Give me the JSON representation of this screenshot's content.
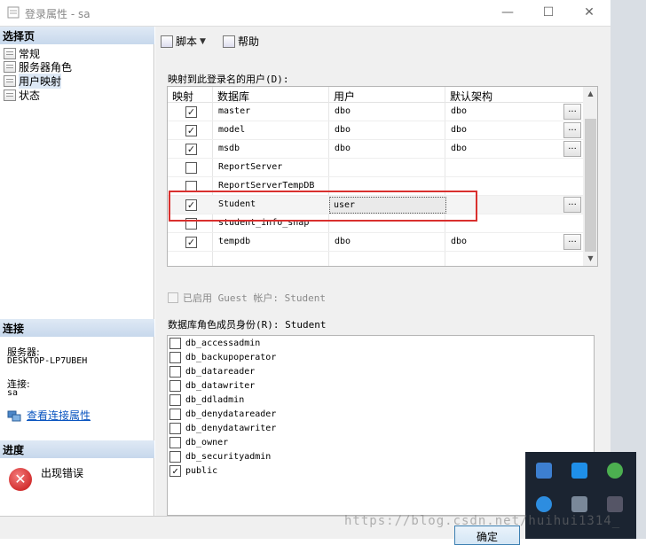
{
  "window": {
    "title": "登录属性 - sa",
    "controls": {
      "minimize": "—",
      "maximize": "☐",
      "close": "✕"
    }
  },
  "left_panel": {
    "select_page_header": "选择页",
    "pages": [
      {
        "label": "常规",
        "icon": "page-icon"
      },
      {
        "label": "服务器角色",
        "icon": "page-icon"
      },
      {
        "label": "用户映射",
        "icon": "page-icon",
        "selected": true
      },
      {
        "label": "状态",
        "icon": "page-icon"
      }
    ],
    "connection": {
      "header": "连接",
      "server_label": "服务器:",
      "server_value": "DESKTOP-LP7UBEH",
      "connection_label": "连接:",
      "connection_value": "sa",
      "view_properties_link": "查看连接属性"
    },
    "progress": {
      "header": "进度",
      "status": "出现错误",
      "status_icon": "error-icon"
    }
  },
  "toolbar": {
    "script_label": "脚本",
    "help_label": "帮助"
  },
  "mapping": {
    "title": "映射到此登录名的用户(D):",
    "columns": [
      "映射",
      "数据库",
      "用户",
      "默认架构"
    ],
    "rows": [
      {
        "mapped": true,
        "database": "master",
        "user": "dbo",
        "schema": "dbo",
        "ellipsis": "..."
      },
      {
        "mapped": true,
        "database": "model",
        "user": "dbo",
        "schema": "dbo",
        "ellipsis": "..."
      },
      {
        "mapped": true,
        "database": "msdb",
        "user": "dbo",
        "schema": "dbo",
        "ellipsis": "..."
      },
      {
        "mapped": false,
        "database": "ReportServer",
        "user": "",
        "schema": "",
        "ellipsis": ""
      },
      {
        "mapped": false,
        "database": "ReportServerTempDB",
        "user": "",
        "schema": "",
        "ellipsis": ""
      },
      {
        "mapped": true,
        "database": "Student",
        "user": "user",
        "schema": "",
        "ellipsis": "...",
        "selected": true
      },
      {
        "mapped": false,
        "database": "student_info_snap",
        "user": "",
        "schema": "",
        "ellipsis": ""
      },
      {
        "mapped": true,
        "database": "tempdb",
        "user": "dbo",
        "schema": "dbo",
        "ellipsis": "..."
      }
    ]
  },
  "guest": {
    "label": "已启用 Guest 帐户: Student",
    "checked": false,
    "enabled": false
  },
  "roles": {
    "title": "数据库角色成员身份(R): Student",
    "items": [
      {
        "name": "db_accessadmin",
        "checked": false
      },
      {
        "name": "db_backupoperator",
        "checked": false
      },
      {
        "name": "db_datareader",
        "checked": false
      },
      {
        "name": "db_datawriter",
        "checked": false
      },
      {
        "name": "db_ddladmin",
        "checked": false
      },
      {
        "name": "db_denydatareader",
        "checked": false
      },
      {
        "name": "db_denydatawriter",
        "checked": false
      },
      {
        "name": "db_owner",
        "checked": false
      },
      {
        "name": "db_securityadmin",
        "checked": false
      },
      {
        "name": "public",
        "checked": true
      }
    ]
  },
  "footer": {
    "ok_label": "确定"
  },
  "watermark": "https://blog.csdn.net/huihui1314_",
  "colors": {
    "highlight_box": "#d9302e",
    "section_header": "#c7d8ec",
    "link": "#0a55c0"
  }
}
